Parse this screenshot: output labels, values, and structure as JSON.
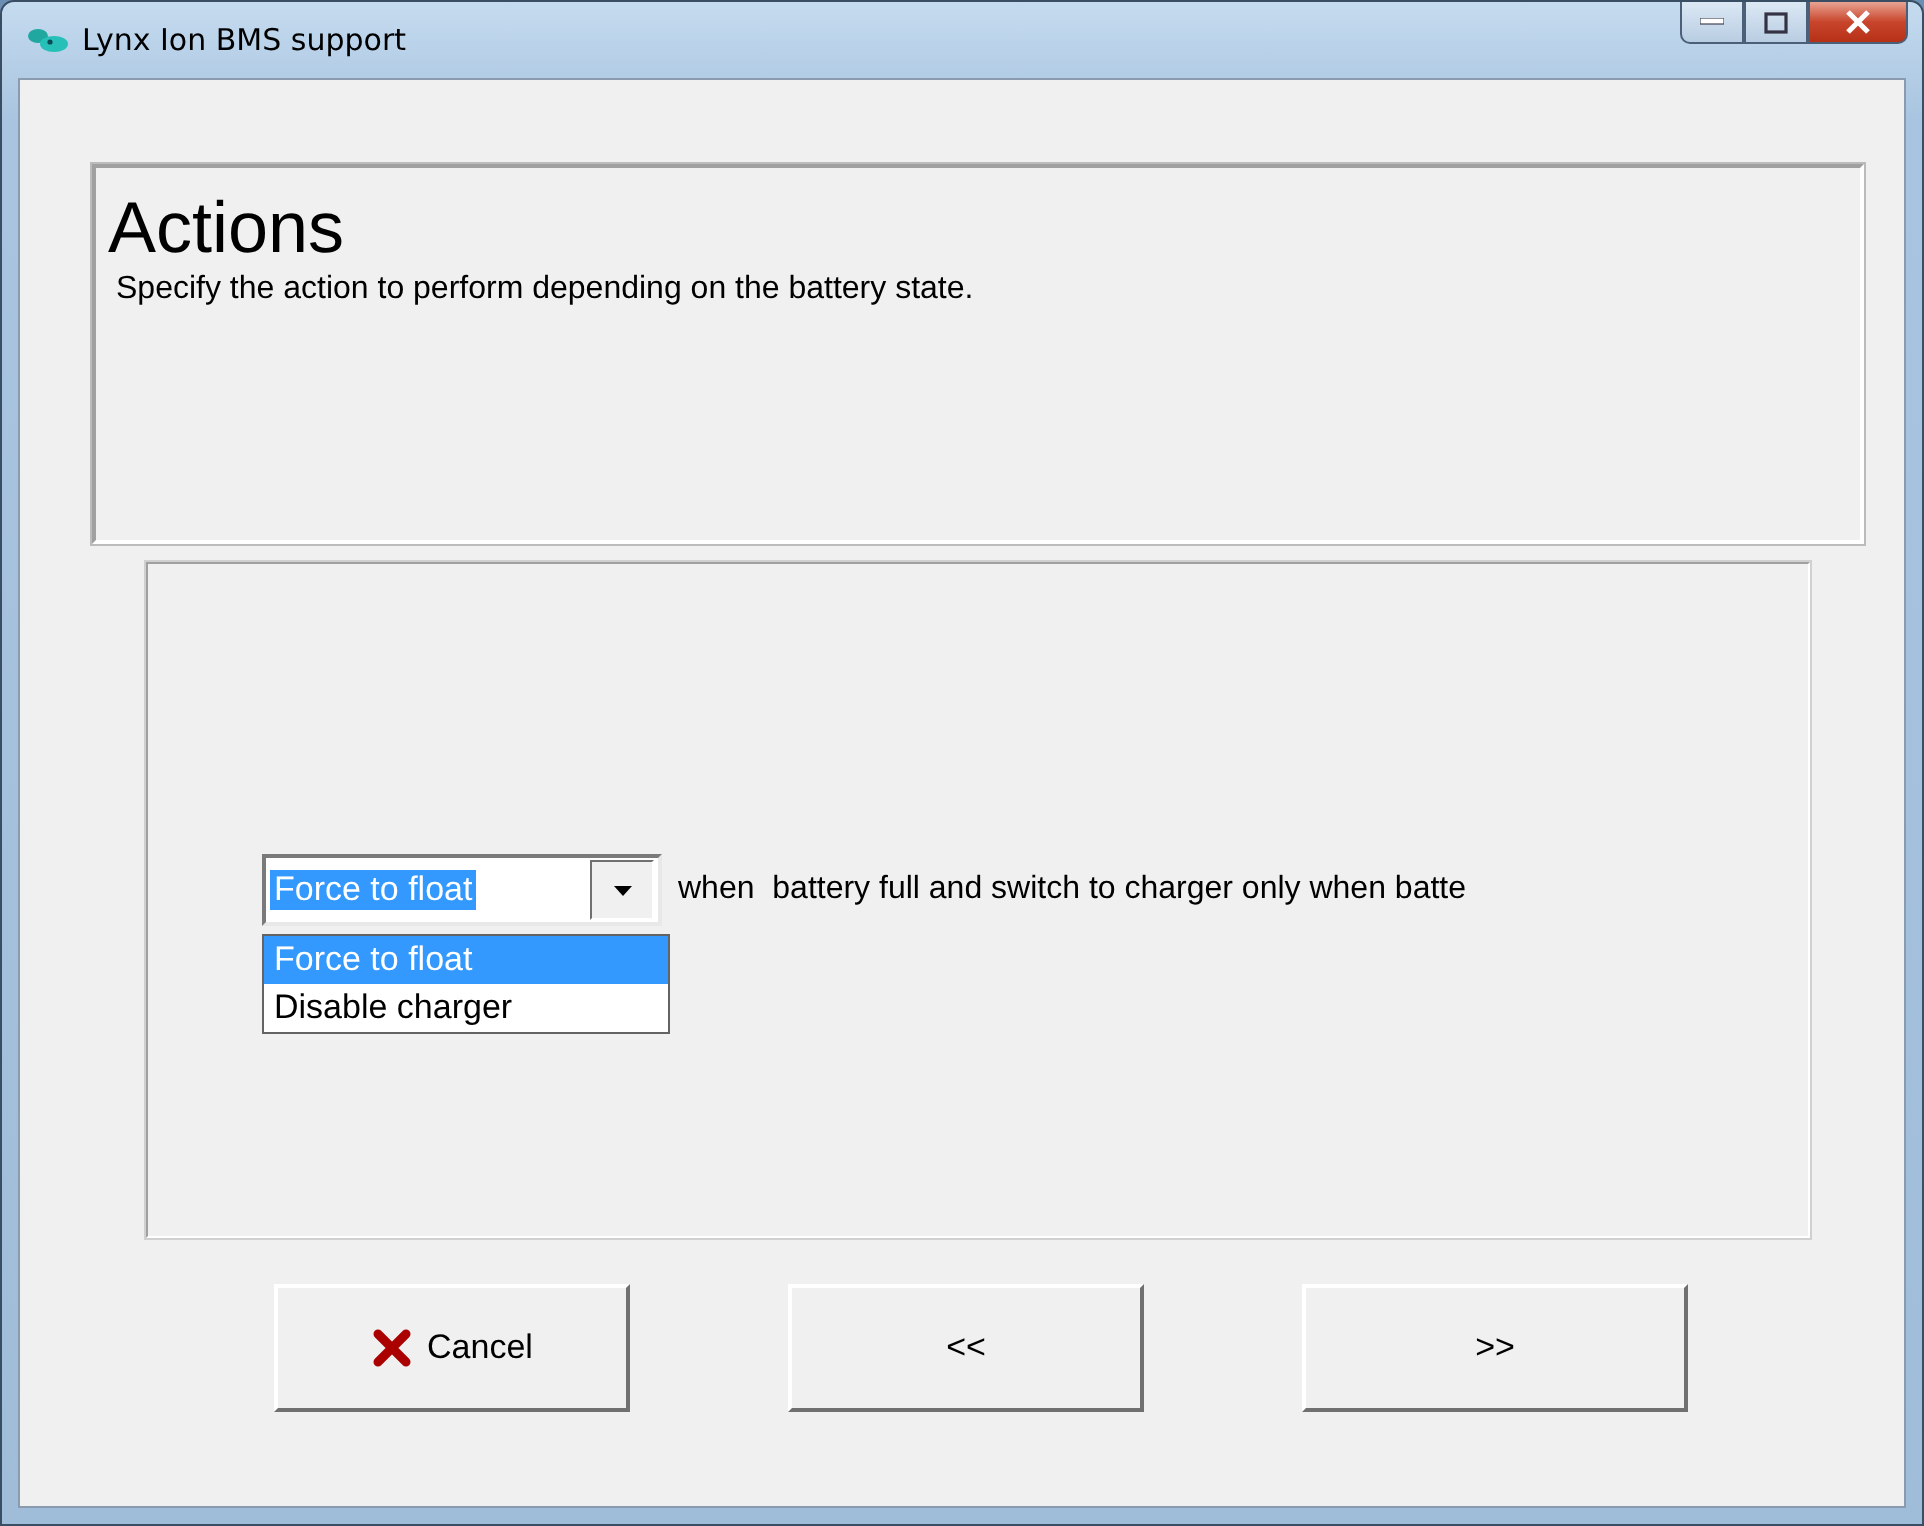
{
  "window": {
    "title": "Lynx Ion BMS support"
  },
  "header": {
    "title": "Actions",
    "description": "Specify the action to perform depending on the battery state."
  },
  "action": {
    "value": "Force to float",
    "expanded": true,
    "sentence": "when  battery full and switch to charger only when batte",
    "options": [
      {
        "label": "Force to float",
        "selected": true
      },
      {
        "label": "Disable charger",
        "selected": false
      }
    ]
  },
  "buttons": [
    {
      "kind": "cancel",
      "label": "Cancel"
    },
    {
      "kind": "back",
      "label": "<<"
    },
    {
      "kind": "next",
      "label": ">>"
    }
  ]
}
